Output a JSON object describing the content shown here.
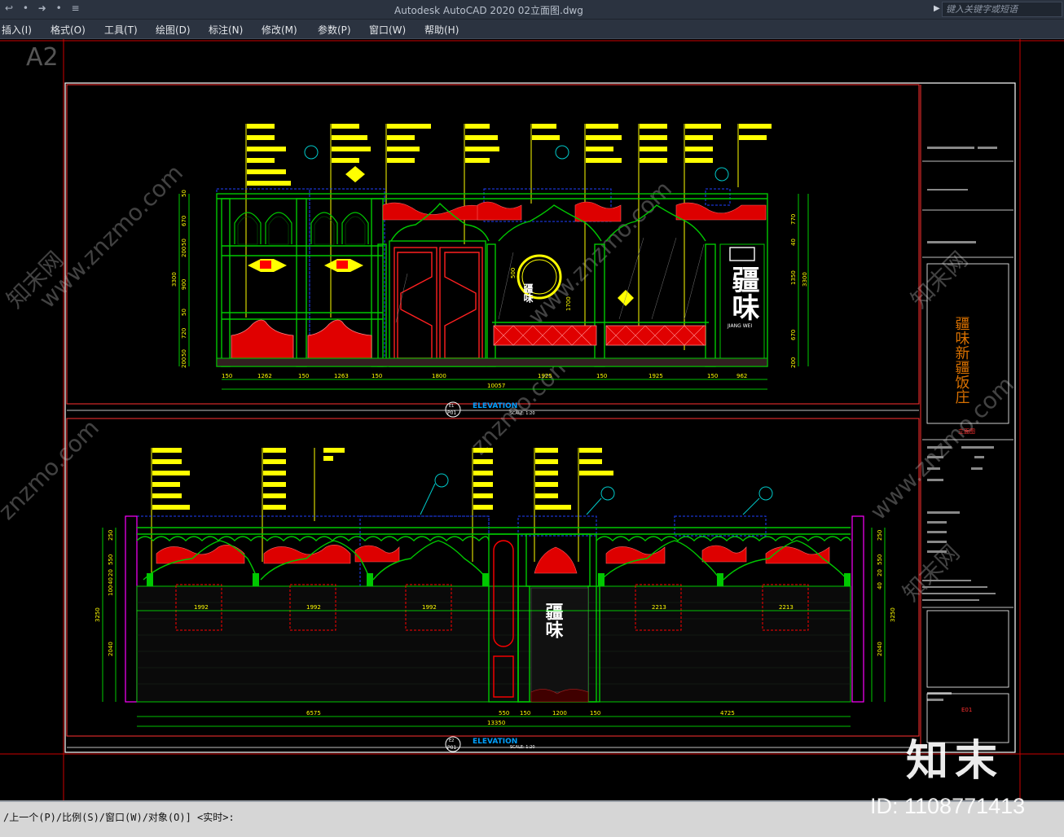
{
  "titlebar": {
    "quick_access": "↩ • ➜ • ≡",
    "title": "Autodesk AutoCAD 2020    02立面图.dwg",
    "search_placeholder": "键入关键字或短语"
  },
  "menu": [
    {
      "label": "插入(I)"
    },
    {
      "label": "格式(O)"
    },
    {
      "label": "工具(T)"
    },
    {
      "label": "绘图(D)"
    },
    {
      "label": "标注(N)"
    },
    {
      "label": "修改(M)"
    },
    {
      "label": "参数(P)"
    },
    {
      "label": "窗口(W)"
    },
    {
      "label": "帮助(H)"
    }
  ],
  "drawing": {
    "sheet_size": "A2",
    "elevation_top": {
      "title": "ELEVATION",
      "tag": "E1",
      "sheet": "P01",
      "scale": "SCALE: 1:20",
      "height_dims": [
        "50",
        "670",
        "50",
        "200",
        "900",
        "50",
        "720",
        "50",
        "200"
      ],
      "height_total": "3300",
      "right_dims": [
        "770",
        "40",
        "1350",
        "670",
        "200"
      ],
      "right_total": "3300",
      "width_dims": [
        "150",
        "1262",
        "150",
        "1263",
        "150",
        "1800",
        "1925",
        "150",
        "1925",
        "150",
        "962"
      ],
      "width_total": "10057",
      "inner_dims": [
        "500",
        "1700"
      ],
      "sign_text": "疆味",
      "sign_small": "JIANG WEI",
      "callouts": [
        "E1",
        "E3",
        "E4",
        "J01"
      ]
    },
    "elevation_bottom": {
      "title": "ELEVATION",
      "tag": "E2",
      "sheet": "P01",
      "scale": "SCALE: 1:20",
      "height_dims": [
        "250",
        "550",
        "20",
        "40",
        "100",
        "3250",
        "2040"
      ],
      "right_dims": [
        "250",
        "550",
        "20",
        "40",
        "3250",
        "2040"
      ],
      "span_dims": [
        "1992",
        "1992",
        "1992",
        "2213",
        "2213"
      ],
      "width_dims": [
        "6575",
        "550",
        "150",
        "1200",
        "150",
        "4725"
      ],
      "width_total": "13350",
      "door_sign": "疆味",
      "callouts": [
        "E2",
        "E3",
        "E4"
      ]
    },
    "title_block": {
      "vertical_title": "疆味新疆饭庄",
      "stamp": "立面图",
      "sheet_no": "E01"
    }
  },
  "watermark": {
    "site": "www.znzmo.com",
    "site_short": "znzmo.com",
    "brand_cn": "知末网",
    "brand": "知末",
    "id": "ID: 1108771413"
  },
  "command_line": "/上一个(P)/比例(S)/窗口(W)/对象(O)] <实时>:",
  "colors": {
    "ui_bg": "#2b3340",
    "canvas": "#000000",
    "cad_green": "#00c800",
    "cad_red": "#ff0000",
    "cad_yellow": "#ffff00",
    "cad_blue": "#2040ff",
    "cad_magenta": "#ff00ff",
    "cad_white": "#ffffff"
  }
}
